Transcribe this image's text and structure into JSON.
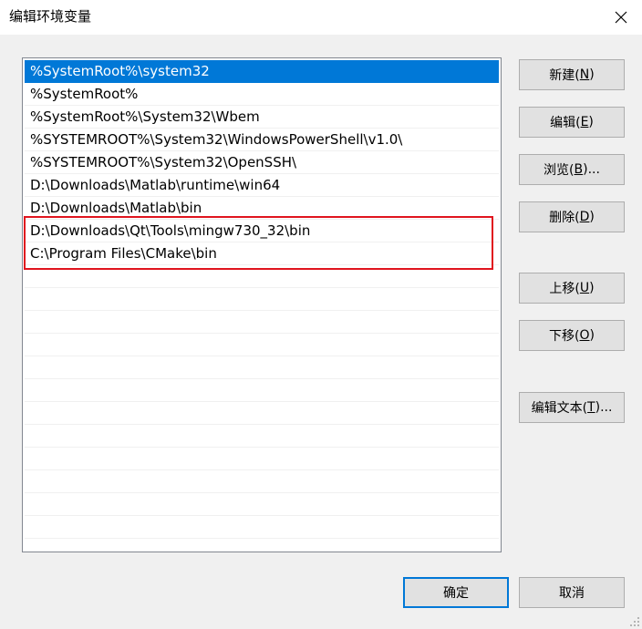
{
  "window": {
    "title": "编辑环境变量",
    "close_icon": "close-icon"
  },
  "path_list": {
    "items": [
      "%SystemRoot%\\system32",
      "%SystemRoot%",
      "%SystemRoot%\\System32\\Wbem",
      "%SYSTEMROOT%\\System32\\WindowsPowerShell\\v1.0\\",
      "%SYSTEMROOT%\\System32\\OpenSSH\\",
      "D:\\Downloads\\Matlab\\runtime\\win64",
      "D:\\Downloads\\Matlab\\bin",
      "D:\\Downloads\\Qt\\Tools\\mingw730_32\\bin",
      "C:\\Program Files\\CMake\\bin"
    ],
    "selected_index": 0,
    "highlight_color": "#e0141e",
    "selection_color": "#0078d7"
  },
  "buttons": {
    "new": {
      "text": "新建(",
      "key": "N",
      "close": ")"
    },
    "edit": {
      "text": "编辑(",
      "key": "E",
      "close": ")"
    },
    "browse": {
      "text": "浏览(",
      "key": "B",
      "close": ")..."
    },
    "delete": {
      "text": "删除(",
      "key": "D",
      "close": ")"
    },
    "move_up": {
      "text": "上移(",
      "key": "U",
      "close": ")"
    },
    "move_down": {
      "text": "下移(",
      "key": "O",
      "close": ")"
    },
    "edit_text": {
      "text": "编辑文本(",
      "key": "T",
      "close": ")..."
    },
    "ok": "确定",
    "cancel": "取消"
  }
}
